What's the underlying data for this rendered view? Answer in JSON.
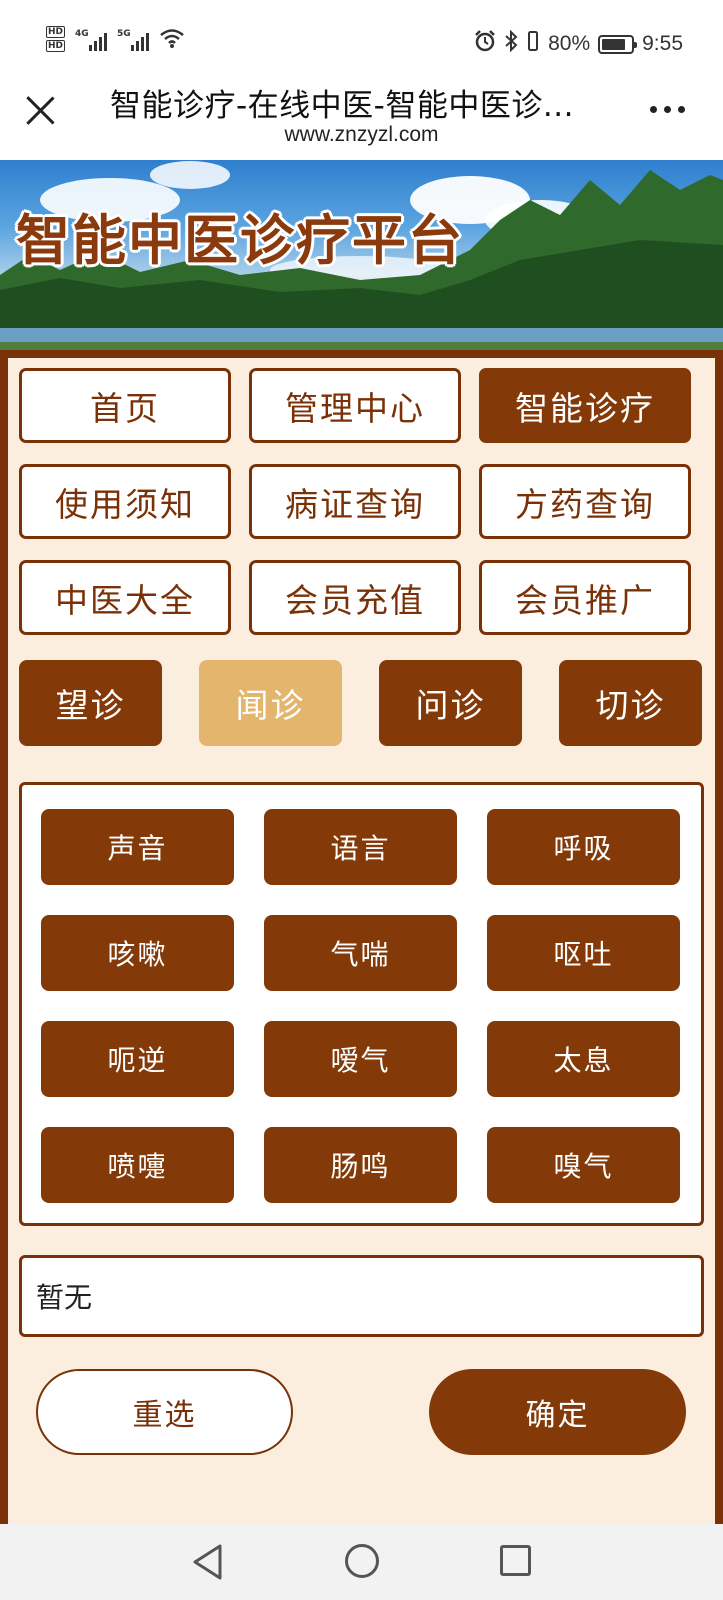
{
  "status_bar": {
    "hd1": "HD",
    "hd2": "HD",
    "net1": "4G",
    "net2": "5G",
    "battery_percent": "80%",
    "time": "9:55"
  },
  "titlebar": {
    "title": "智能诊疗-在线中医-智能中医诊...",
    "url": "www.znzyzl.com"
  },
  "banner": {
    "title": "智能中医诊疗平台"
  },
  "nav": {
    "items": [
      {
        "label": "首页"
      },
      {
        "label": "管理中心"
      },
      {
        "label": "智能诊疗",
        "active": true
      },
      {
        "label": "使用须知"
      },
      {
        "label": "病证查询"
      },
      {
        "label": "方药查询"
      },
      {
        "label": "中医大全"
      },
      {
        "label": "会员充值"
      },
      {
        "label": "会员推广"
      }
    ]
  },
  "diagnosis_tabs": {
    "items": [
      {
        "label": "望诊"
      },
      {
        "label": "闻诊",
        "selected": true
      },
      {
        "label": "问诊"
      },
      {
        "label": "切诊"
      }
    ]
  },
  "symptoms": {
    "items": [
      {
        "label": "声音"
      },
      {
        "label": "语言"
      },
      {
        "label": "呼吸"
      },
      {
        "label": "咳嗽"
      },
      {
        "label": "气喘"
      },
      {
        "label": "呕吐"
      },
      {
        "label": "呃逆"
      },
      {
        "label": "嗳气"
      },
      {
        "label": "太息"
      },
      {
        "label": "喷嚏"
      },
      {
        "label": "肠鸣"
      },
      {
        "label": "嗅气"
      }
    ]
  },
  "result": {
    "text": "暂无"
  },
  "actions": {
    "reset_label": "重选",
    "confirm_label": "确定"
  },
  "colors": {
    "primary": "#833a08",
    "selected_tab": "#e3b56d",
    "background": "#fbeedf"
  }
}
